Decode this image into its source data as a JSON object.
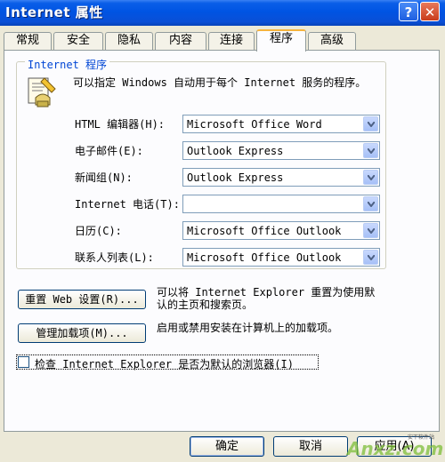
{
  "window": {
    "title": "Internet 属性",
    "help_glyph": "?",
    "close_glyph": "✕"
  },
  "tabs": [
    {
      "label": "常规"
    },
    {
      "label": "安全"
    },
    {
      "label": "隐私"
    },
    {
      "label": "内容"
    },
    {
      "label": "连接"
    },
    {
      "label": "程序",
      "active": true
    },
    {
      "label": "高级"
    }
  ],
  "programs": {
    "group_title": "Internet 程序",
    "description": "可以指定 Windows 自动用于每个 Internet 服务的程序。",
    "icon": "program-settings-icon",
    "rows": [
      {
        "label": "HTML 编辑器(H):",
        "value": "Microsoft Office Word"
      },
      {
        "label": "电子邮件(E):",
        "value": "Outlook Express"
      },
      {
        "label": "新闻组(N):",
        "value": "Outlook Express"
      },
      {
        "label": "Internet 电话(T):",
        "value": ""
      },
      {
        "label": "日历(C):",
        "value": "Microsoft Office Outlook"
      },
      {
        "label": "联系人列表(L):",
        "value": "Microsoft Office Outlook"
      }
    ]
  },
  "reset": {
    "button": "重置 Web 设置(R)...",
    "text_line1": "可以将 Internet Explorer 重置为使用默",
    "text_line2": "认的主页和搜索页。"
  },
  "addons": {
    "button": "管理加载项(M)...",
    "text": "启用或禁用安装在计算机上的加载项。"
  },
  "default_check": {
    "checked": false,
    "label": "检查 Internet Explorer 是否为默认的浏览器(I)"
  },
  "footer": {
    "ok": "确定",
    "cancel": "取消",
    "apply": "应用(A)"
  },
  "watermark": {
    "text": "Anxz.com",
    "small": "安下软件站"
  },
  "colors": {
    "title_bar": "#0054e3",
    "dialog_bg": "#ECE9D8",
    "tab_accent": "#f6b33d",
    "group_title": "#0046d5"
  }
}
